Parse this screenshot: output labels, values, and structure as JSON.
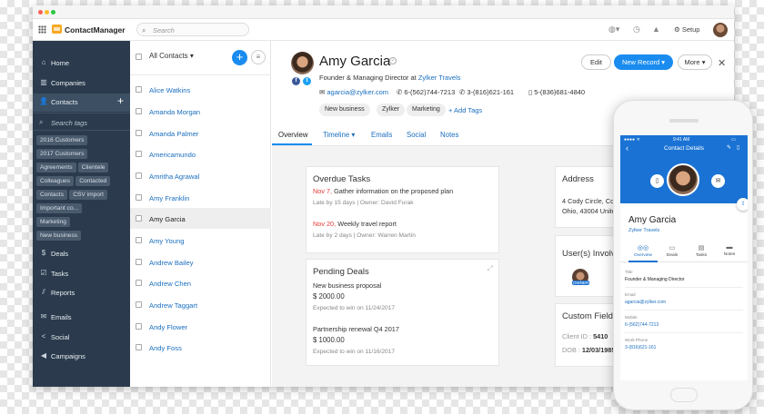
{
  "app": {
    "brand": "ContactManager",
    "search_placeholder": "Search",
    "setup_label": "Setup"
  },
  "sidebar": {
    "items": [
      {
        "label": "Home",
        "icon": "home-icon"
      },
      {
        "label": "Companies",
        "icon": "building-icon"
      },
      {
        "label": "Contacts",
        "icon": "contacts-icon"
      },
      {
        "label": "Deals",
        "icon": "dollar-icon"
      },
      {
        "label": "Tasks",
        "icon": "tasks-icon"
      },
      {
        "label": "Reports",
        "icon": "chart-icon"
      },
      {
        "label": "Emails",
        "icon": "mail-icon"
      },
      {
        "label": "Social",
        "icon": "share-icon"
      },
      {
        "label": "Campaigns",
        "icon": "megaphone-icon"
      }
    ],
    "search_tags_placeholder": "Search tags",
    "tags": [
      "2016 Customers",
      "2017 Customers",
      "Agreements",
      "Clientele",
      "Colleagues",
      "Contacted",
      "Contacts",
      "CSV import",
      "Important co...",
      "Marketing",
      "New business"
    ]
  },
  "list": {
    "filter_label": "All Contacts",
    "contacts": [
      "Alice Watkins",
      "Amanda Morgan",
      "Amanda Palmer",
      "Americamundo",
      "Amritha Agrawal",
      "Amy Franklin",
      "Amy Garcia",
      "Amy Young",
      "Andrew Bailey",
      "Andrew Chen",
      "Andrew Taggart",
      "Andy Flower",
      "Andy Foss"
    ],
    "selected_index": 6
  },
  "profile": {
    "name": "Amy Garcia",
    "title_prefix": "Founder & Managing Director at",
    "company": "Zylker Travels",
    "email": "agarcia@zylker.com",
    "phone1": "6-(562)744-7213",
    "phone2": "3-(816)621-161",
    "phone3": "5-(836)681-4840",
    "tags": [
      "New business",
      "Zylker",
      "Marketing"
    ],
    "add_tags_label": "+ Add Tags",
    "buttons": {
      "edit": "Edit",
      "new_record": "New Record",
      "more": "More"
    }
  },
  "tabs": [
    "Overview",
    "Timeline",
    "Emails",
    "Social",
    "Notes"
  ],
  "overdue": {
    "title": "Overdue Tasks",
    "tasks": [
      {
        "date": "Nov 7,",
        "text": "Gather information on the proposed plan",
        "meta": "Late by 15 days | Owner: David Furak"
      },
      {
        "date": "Nov 20,",
        "text": "Weekly travel report",
        "meta": "Late by 2 days | Owner: Warren Martin"
      }
    ]
  },
  "deals": {
    "title": "Pending Deals",
    "items": [
      {
        "name": "New business proposal",
        "amount": "$ 2000.00",
        "expected": "Expected to win on 11/24/2017"
      },
      {
        "name": "Partnership renewal Q4 2017",
        "amount": "$ 1000.00",
        "expected": "Expected to win on 11/16/2017"
      }
    ]
  },
  "address": {
    "title": "Address",
    "line1": "4 Cody Circle, Columbus",
    "line2": "Ohio, 43004 United State"
  },
  "users": {
    "title": "User(s) Involved",
    "owner_label": "OWNER"
  },
  "custom": {
    "title": "Custom Fields",
    "client_label": "Client ID :",
    "client_value": "5410",
    "dob_label": "DOB :",
    "dob_value": "12/03/1985"
  },
  "phone": {
    "time": "9:41 AM",
    "header_title": "Contact Details",
    "name": "Amy Garcia",
    "company": "Zylker Travels",
    "tabs": [
      "Overview",
      "Deals",
      "Tasks",
      "Notes"
    ],
    "fields": [
      {
        "label": "Title",
        "value": "Founder & Managing Director"
      },
      {
        "label": "Email",
        "value": "agarcia@zylker.com"
      },
      {
        "label": "Mobile",
        "value": "6-(562)744-7213"
      },
      {
        "label": "Work Phone",
        "value": "3-(816)621-161"
      }
    ]
  },
  "colors": {
    "accent": "#1a8cf0",
    "sidebar": "#2b3b4d",
    "overdue_date": "#e53935"
  }
}
